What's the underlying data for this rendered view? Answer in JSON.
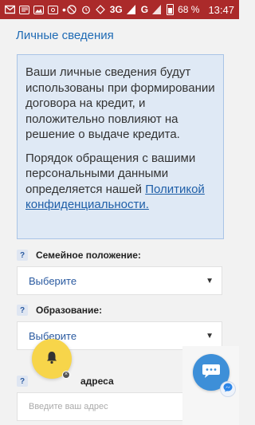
{
  "status_bar": {
    "network": "3G",
    "network2": "G",
    "battery": "68 %",
    "time": "13:47"
  },
  "section": {
    "title": "Личные сведения"
  },
  "info": {
    "paragraph1": "Ваши личные сведения будут использованы при формировании договора на кредит, и положительно повлияют на решение о выдаче кредита.",
    "paragraph2_prefix": "Порядок обращения с вашими персональными данными определяется нашей ",
    "paragraph2_link": "Политикой конфиденциальности."
  },
  "fields": {
    "marital": {
      "help": "?",
      "label": "Семейное положение:",
      "value": "Выберите"
    },
    "education": {
      "help": "?",
      "label": "Образование:",
      "value": "Выберите"
    },
    "address": {
      "help": "?",
      "label": "адреса",
      "placeholder": "Введите ваш адрес"
    }
  },
  "icons": {
    "bell": "bell-icon",
    "chat": "chat-icon"
  },
  "colors": {
    "status_bar": "#ab2a2a",
    "accent": "#1f6bb5",
    "info_bg": "#dfe9f5",
    "bell_fab": "#f7d54a",
    "chat_fab": "#3d8fd8"
  }
}
